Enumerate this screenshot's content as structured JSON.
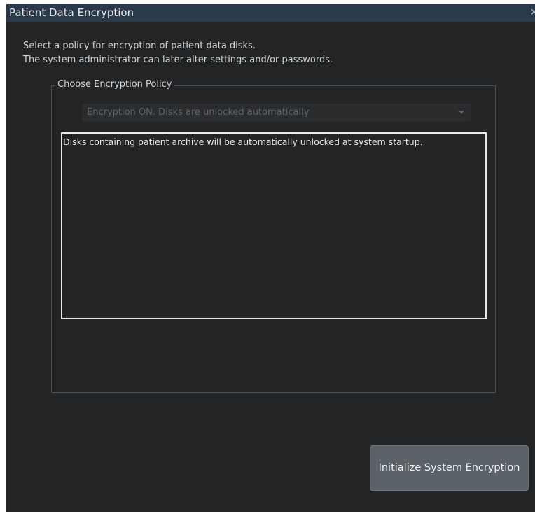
{
  "window": {
    "title": "Patient Data Encryption",
    "close_glyph": "×"
  },
  "intro": {
    "line1": "Select a policy for encryption of patient data disks.",
    "line2": "The system administrator can later alter settings and/or passwords."
  },
  "policy_group": {
    "legend": "Choose Encryption Policy",
    "selected_policy": "Encryption ON. Disks are unlocked automatically",
    "dropdown_icon": "chevron-down-icon",
    "description": "Disks containing patient archive will be automatically unlocked at system startup."
  },
  "actions": {
    "initialize_label": "Initialize System Encryption"
  },
  "colors": {
    "window_bg": "#232425",
    "titlebar_bg": "#2b3a4a",
    "button_bg": "#5b6268",
    "disabled_text": "#5f6468"
  }
}
